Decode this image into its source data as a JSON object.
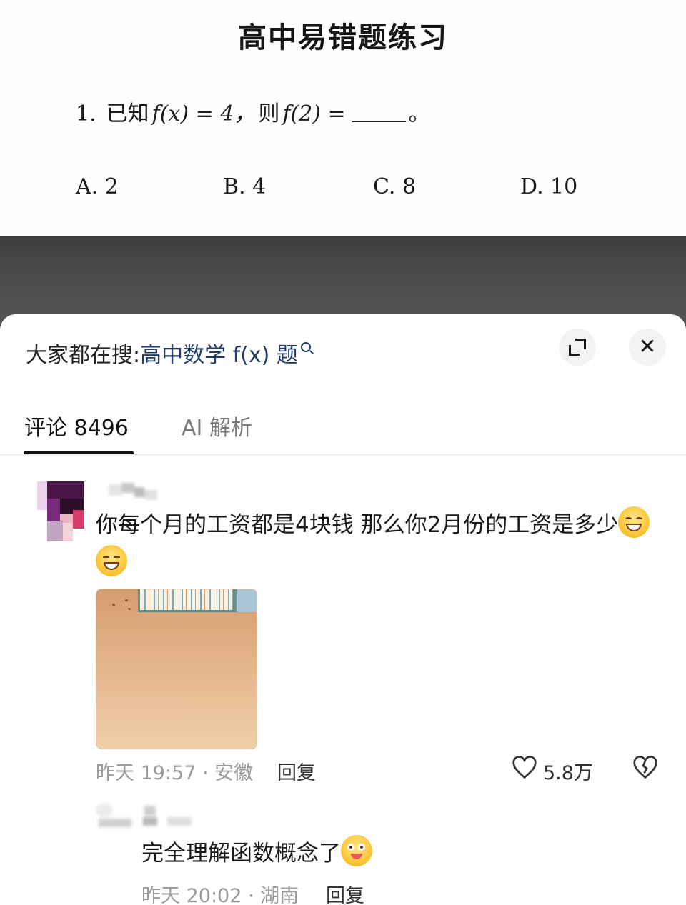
{
  "worksheet": {
    "title": "高中易错题练习",
    "question": {
      "number": "1.",
      "prefix": "已知",
      "given": "f(x) = 4，",
      "then": "则",
      "ask": "f(2) =",
      "suffix": "。"
    },
    "options": [
      "A. 2",
      "B. 4",
      "C. 8",
      "D. 10"
    ]
  },
  "panel": {
    "search_label": "大家都在搜:",
    "search_term": "高中数学 f(x) 题",
    "tabs": [
      {
        "label": "评论 8496",
        "active": true
      },
      {
        "label": "AI 解析",
        "active": false
      }
    ]
  },
  "comments": [
    {
      "text": "你每个月的工资都是4块钱 那么你2月份的工资是多少",
      "emojis": [
        "grin-emoji",
        "grin-emoji"
      ],
      "has_image": true,
      "time_location": "昨天 19:57 · 安徽",
      "reply_label": "回复",
      "likes": "5.8万"
    },
    {
      "text": "完全理解函数概念了",
      "emojis": [
        "dizzy-face-emoji"
      ],
      "time_location": "昨天 20:02 · 湖南",
      "reply_label": "回复"
    }
  ],
  "colors": {
    "search_term": "#1f3b66",
    "dark_band": "#4a4a4a",
    "meta_text": "#9a9a9a"
  }
}
